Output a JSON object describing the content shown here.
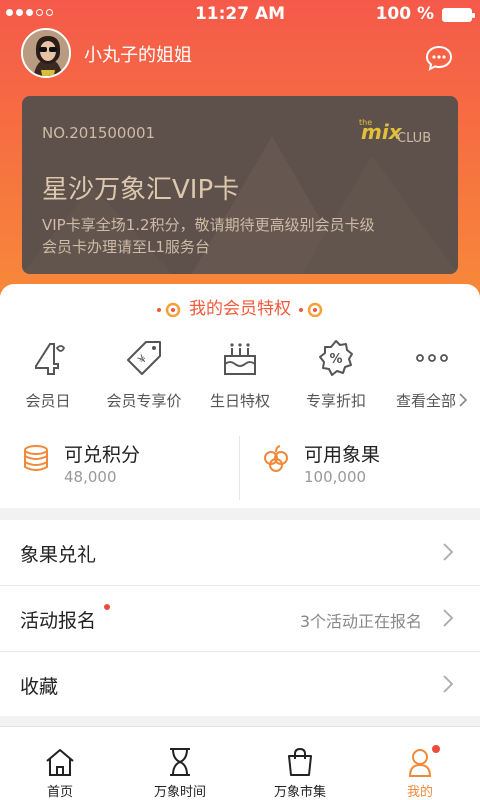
{
  "status": {
    "time": "11:27 AM",
    "battery": "100 %"
  },
  "profile": {
    "name": "小丸子的姐姐"
  },
  "card": {
    "number": "NO.201500001",
    "title": "星沙万象汇VIP卡",
    "desc_line1": "VIP卡享全场1.2积分，敬请期待更高级别会员卡级",
    "desc_line2": "会员卡办理请至L1服务台",
    "logo_small": "the",
    "logo_main": "mix",
    "logo_club": "CLUB"
  },
  "privileges": {
    "title": "我的会员特权",
    "items": [
      {
        "label": "会员日",
        "icon": "member-day-icon"
      },
      {
        "label": "会员专享价",
        "icon": "price-tag-icon"
      },
      {
        "label": "生日特权",
        "icon": "birthday-cake-icon"
      },
      {
        "label": "专享折扣",
        "icon": "discount-icon"
      },
      {
        "label": "查看全部",
        "icon": "more-icon"
      }
    ]
  },
  "points": {
    "redeemable": {
      "label": "可兑积分",
      "value": "48,000"
    },
    "fruit": {
      "label": "可用象果",
      "value": "100,000"
    }
  },
  "menu": [
    {
      "label": "象果兑礼",
      "right": ""
    },
    {
      "label": "活动报名",
      "right": "3个活动正在报名"
    },
    {
      "label": "收藏",
      "right": ""
    }
  ],
  "tabs": [
    {
      "label": "首页"
    },
    {
      "label": "万象时间"
    },
    {
      "label": "万象市集"
    },
    {
      "label": "我的"
    }
  ],
  "colors": {
    "accent": "#f05a3a",
    "card": "#5e514b",
    "gold": "#dcc8ad",
    "active_tab": "#f08a3a"
  }
}
